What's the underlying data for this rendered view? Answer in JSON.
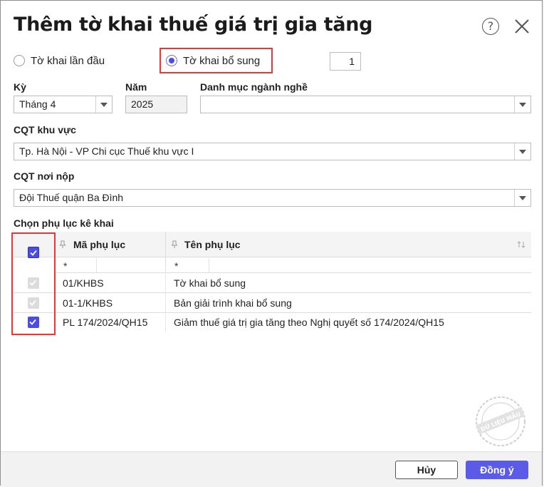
{
  "dialog": {
    "title": "Thêm tờ khai thuế giá trị gia tăng",
    "help_glyph": "?"
  },
  "declaration_type": {
    "options": [
      {
        "label": "Tờ khai lần đầu",
        "selected": false
      },
      {
        "label": "Tờ khai bổ sung",
        "selected": true
      }
    ],
    "supplement_number": "1"
  },
  "period": {
    "label": "Kỳ",
    "value": "Tháng 4"
  },
  "year": {
    "label": "Năm",
    "value": "2025"
  },
  "industry": {
    "label": "Danh mục ngành nghề",
    "value": ""
  },
  "tax_office_region": {
    "label": "CQT khu vực",
    "value": "Tp. Hà Nội - VP Chi cục Thuế khu vực I"
  },
  "tax_office_submit": {
    "label": "CQT nơi nộp",
    "value": "Đội Thuế quận Ba Đình"
  },
  "appendix": {
    "label": "Chọn phụ lục kê khai",
    "columns": [
      "Mã phụ lục",
      "Tên phụ lục"
    ],
    "filter_placeholder": "*",
    "rows": [
      {
        "code": "01/KHBS",
        "name": "Tờ khai bổ sung",
        "checked": true,
        "disabled": true
      },
      {
        "code": "01-1/KHBS",
        "name": "Bản giải trình khai bổ sung",
        "checked": true,
        "disabled": true
      },
      {
        "code": "PL 174/2024/QH15",
        "name": "Giảm thuế giá trị gia tăng theo Nghị quyết số 174/2024/QH15",
        "checked": true,
        "disabled": false
      }
    ]
  },
  "watermark": {
    "text": "DỮ LIỆU MẪU"
  },
  "footer": {
    "cancel_label": "Hủy",
    "ok_label": "Đồng ý"
  },
  "colors": {
    "accent": "#5b5be8",
    "highlight": "#e53935"
  }
}
